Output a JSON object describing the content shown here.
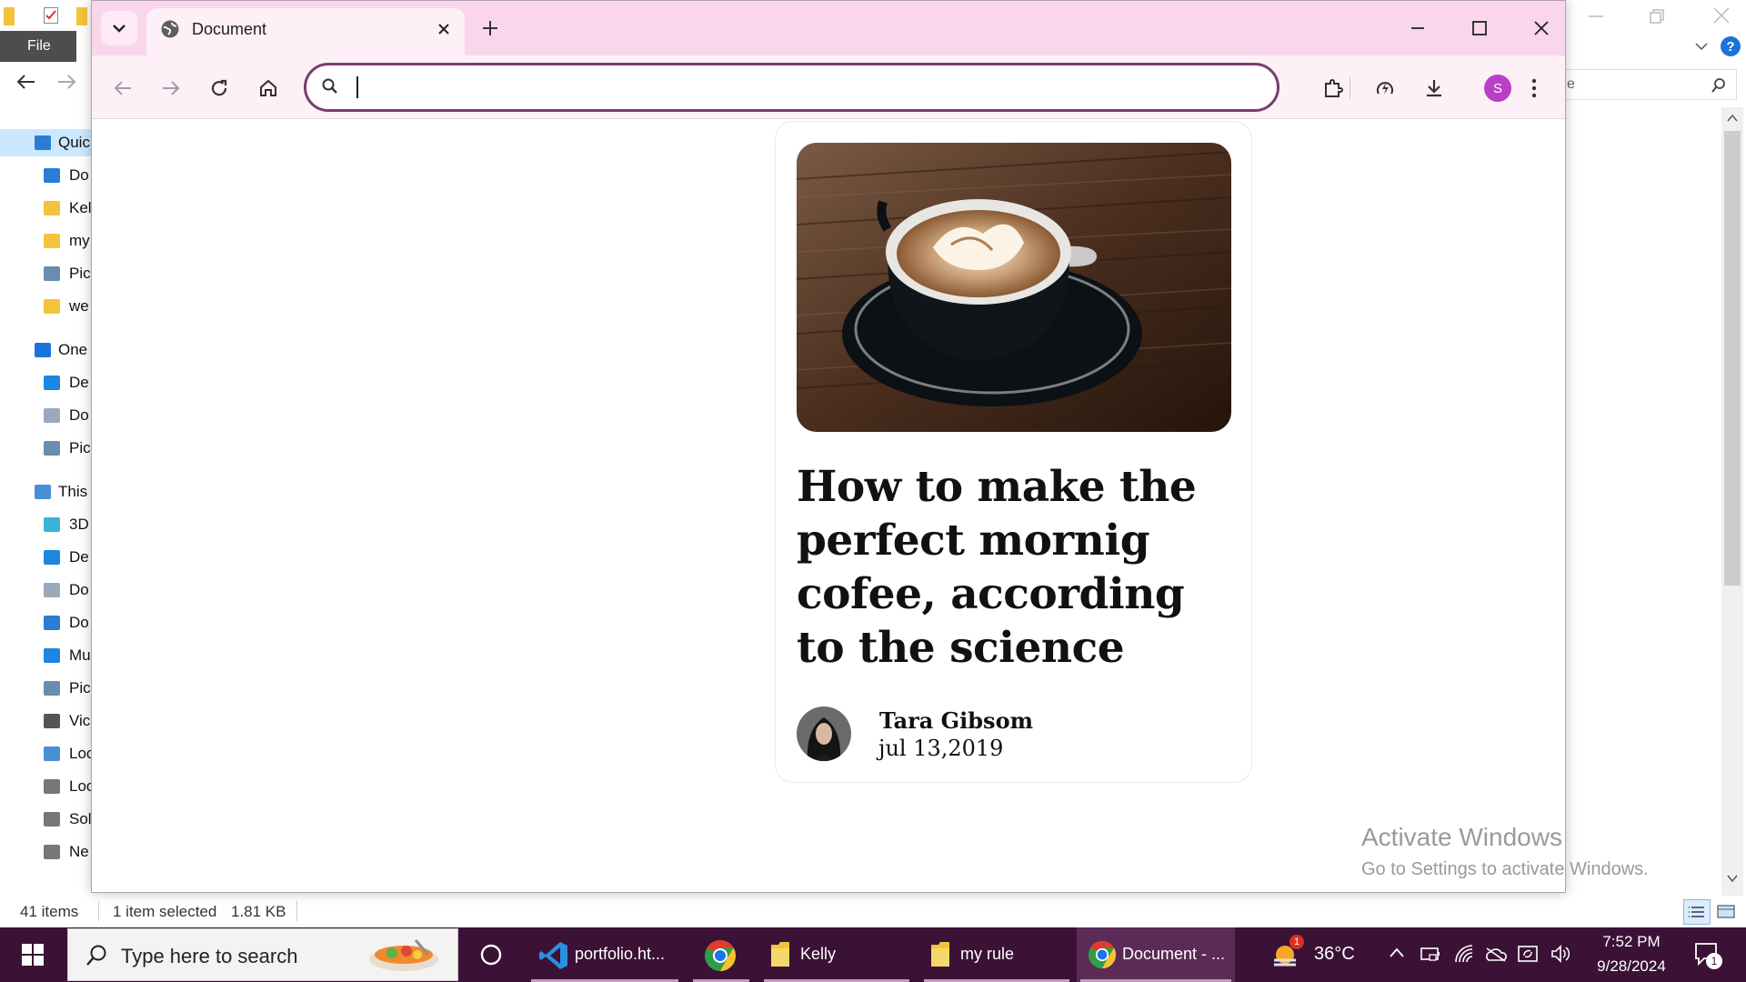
{
  "explorer": {
    "file_tab": "File",
    "tree": [
      {
        "label": "Quic",
        "icon": "star-icon",
        "color": "#2b7cd3",
        "selected": true
      },
      {
        "label": "Do",
        "icon": "download-icon",
        "color": "#2b7cd3"
      },
      {
        "label": "Kel",
        "icon": "folder-icon",
        "color": "#f3c33b"
      },
      {
        "label": "my",
        "icon": "folder-icon",
        "color": "#f3c33b"
      },
      {
        "label": "Pic",
        "icon": "pictures-icon",
        "color": "#6a8caf"
      },
      {
        "label": "we",
        "icon": "folder-icon",
        "color": "#f3c33b"
      },
      {
        "label": "One",
        "icon": "onedrive-icon",
        "color": "#1a73d9"
      },
      {
        "label": "De",
        "icon": "desktop-icon",
        "color": "#1c86e0"
      },
      {
        "label": "Do",
        "icon": "document-icon",
        "color": "#9ab"
      },
      {
        "label": "Pic",
        "icon": "pictures-icon",
        "color": "#6a8caf"
      },
      {
        "label": "This",
        "icon": "computer-icon",
        "color": "#4a8fd6"
      },
      {
        "label": "3D",
        "icon": "cube-icon",
        "color": "#3bb3d6"
      },
      {
        "label": "De",
        "icon": "desktop-icon",
        "color": "#1c86e0"
      },
      {
        "label": "Do",
        "icon": "document-icon",
        "color": "#9ab"
      },
      {
        "label": "Do",
        "icon": "download-icon",
        "color": "#2b7cd3"
      },
      {
        "label": "Mu",
        "icon": "music-icon",
        "color": "#1c86e0"
      },
      {
        "label": "Pic",
        "icon": "pictures-icon",
        "color": "#6a8caf"
      },
      {
        "label": "Vic",
        "icon": "video-icon",
        "color": "#555"
      },
      {
        "label": "Loc",
        "icon": "drive-icon",
        "color": "#4a8fd6"
      },
      {
        "label": "Loc",
        "icon": "drive-icon",
        "color": "#777"
      },
      {
        "label": "Sol",
        "icon": "drive-icon",
        "color": "#777"
      },
      {
        "label": "Ne",
        "icon": "drive-icon",
        "color": "#777"
      }
    ],
    "status_items": "41 items",
    "status_selected": "1 item selected",
    "status_size": "1.81 KB",
    "search_placeholder_fragment": "e"
  },
  "browser": {
    "tab_title": "Document",
    "address_value": "",
    "profile_initial": "S",
    "accent": "#7d3c6b",
    "tabstrip_color": "#f9d6eb"
  },
  "page": {
    "title": "How to make the perfect mornig cofee, according to the science",
    "author": "Tara Gibsom",
    "date": "jul 13,2019"
  },
  "watermark": {
    "title": "Activate Windows",
    "subtitle": "Go to Settings to activate Windows."
  },
  "taskbar": {
    "search_placeholder": "Type here to search",
    "apps": [
      {
        "label": "portfolio.ht...",
        "icon": "vscode-icon"
      },
      {
        "label": "",
        "icon": "chrome-icon"
      },
      {
        "label": "Kelly",
        "icon": "folder-icon"
      },
      {
        "label": "my rule",
        "icon": "folder-icon"
      },
      {
        "label": "Document - ...",
        "icon": "chrome-icon"
      }
    ],
    "weather_temp": "36°C",
    "weather_badge": "1",
    "notification_count": "1",
    "time": "7:52 PM",
    "date": "9/28/2024"
  }
}
